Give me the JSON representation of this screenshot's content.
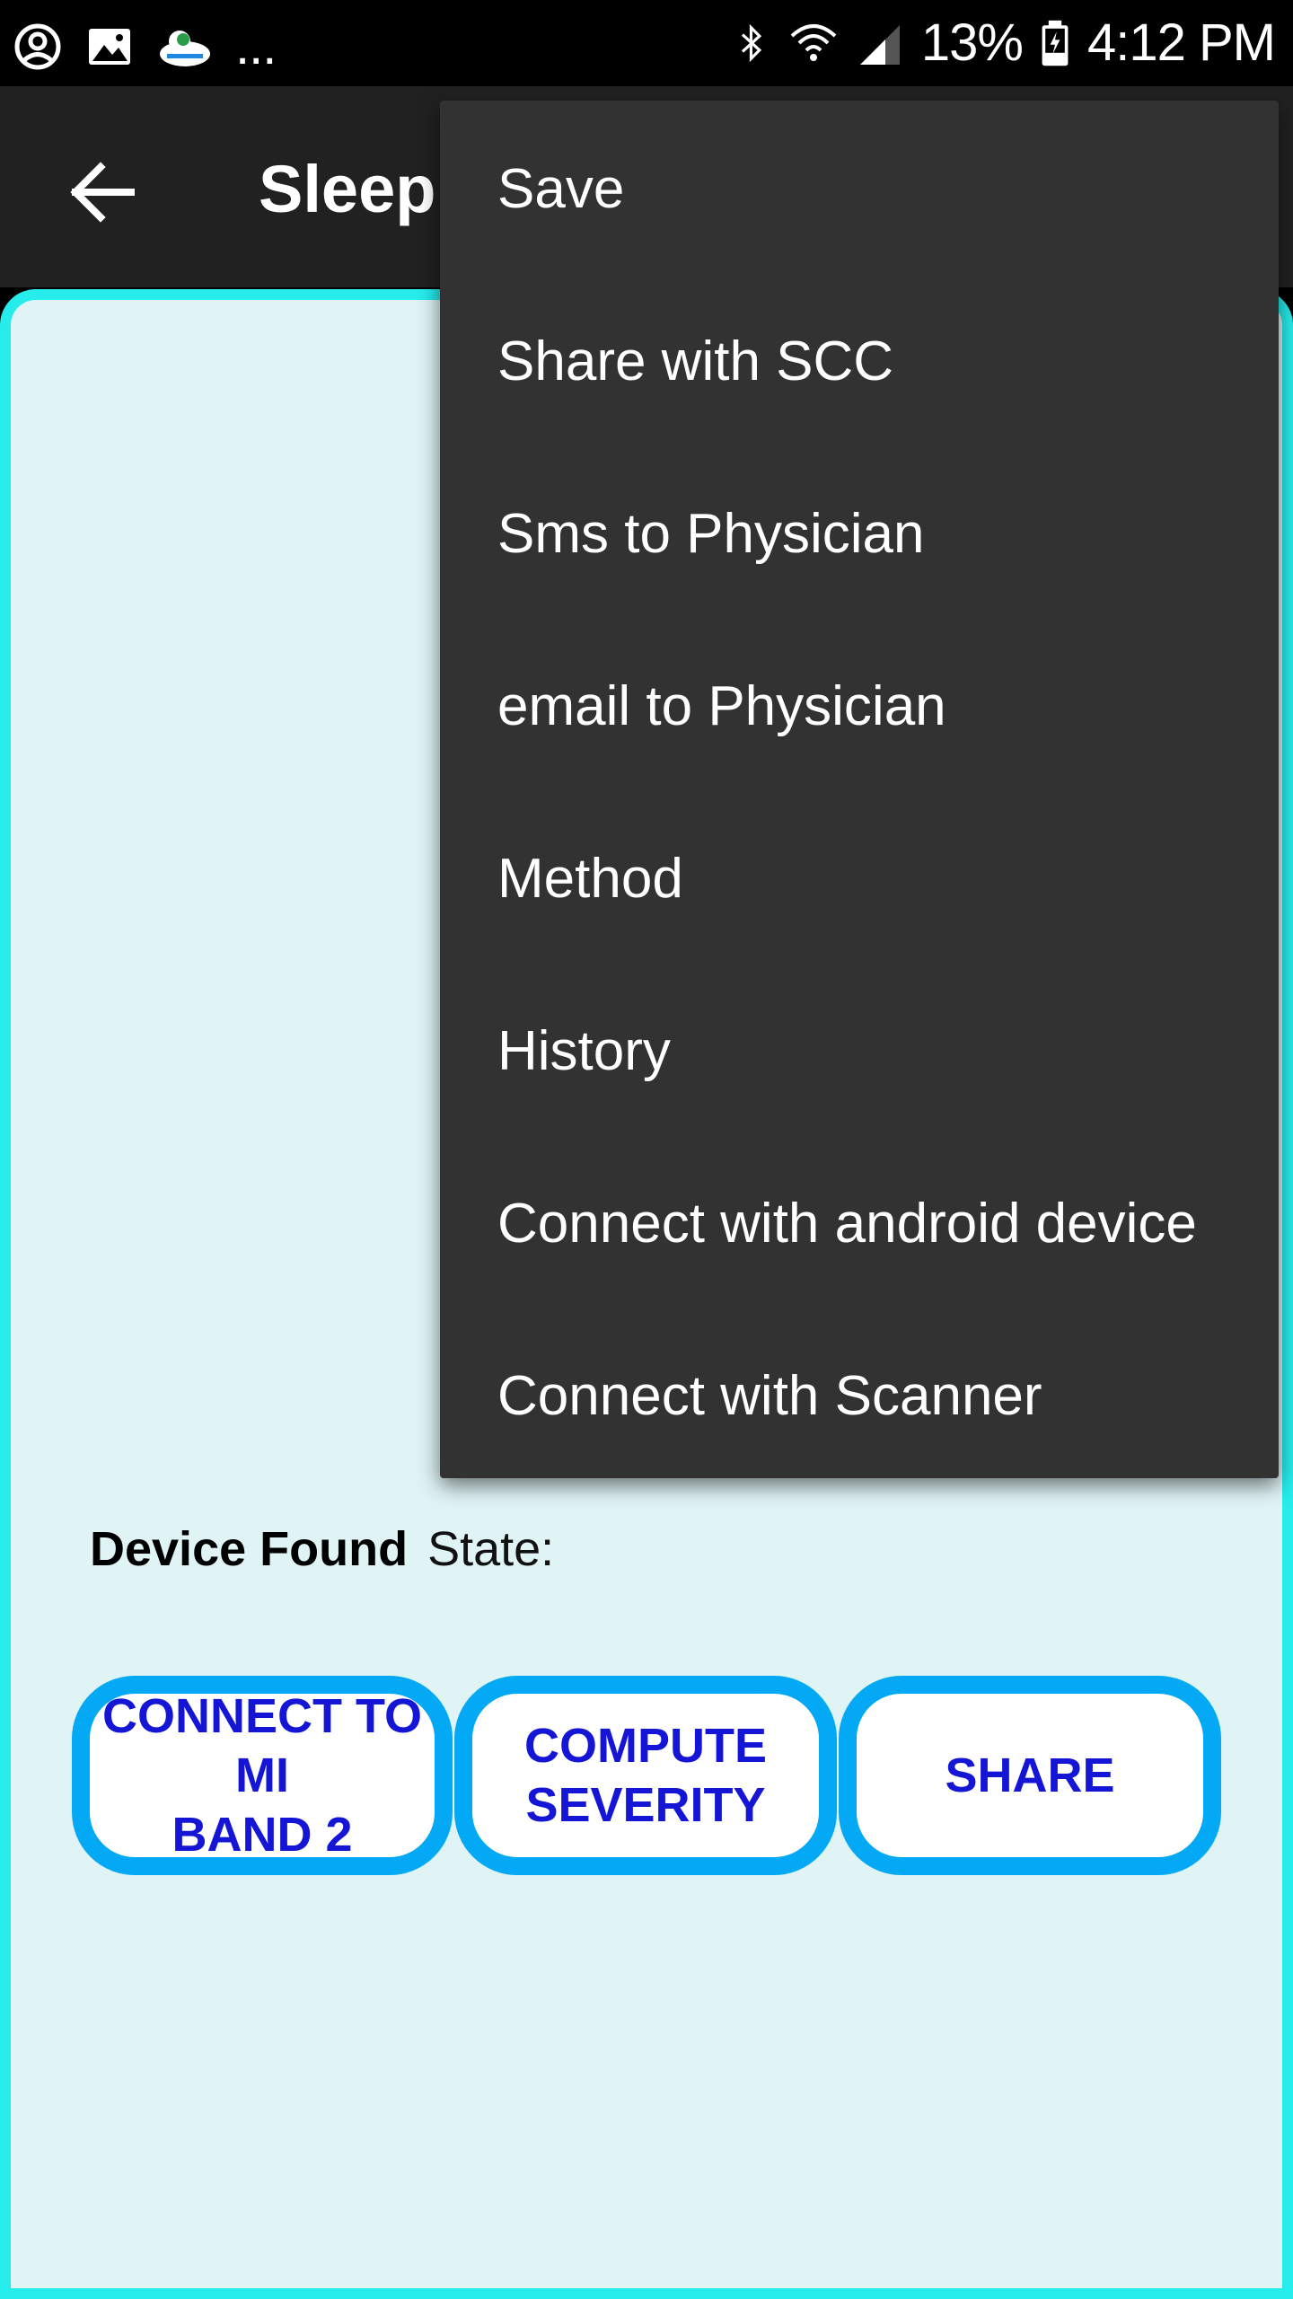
{
  "status_bar": {
    "icons_left": [
      "account-circle-icon",
      "image-icon",
      "app-cloud-icon"
    ],
    "overflow_dots": "...",
    "icons_right": [
      "bluetooth-icon",
      "wifi-icon",
      "signal-icon",
      "battery-icon"
    ],
    "battery_percent": "13%",
    "time": "4:12 PM"
  },
  "app_bar": {
    "title": "Sleep",
    "back_icon": "arrow-back-icon"
  },
  "main": {
    "device_found_label": "Device Found",
    "state_label": "State:",
    "buttons": {
      "connect": "CONNECT TO MI\nBAND 2",
      "compute": "COMPUTE\nSEVERITY",
      "share": "SHARE"
    }
  },
  "menu": {
    "items": [
      "Save",
      "Share with SCC",
      "Sms to Physician",
      "email to Physician",
      "Method",
      "History",
      "Connect with android device",
      "Connect with Scanner"
    ]
  },
  "colors": {
    "status_bar": "#000000",
    "app_bar": "#212121",
    "content_bg": "#e0f4f6",
    "content_border": "#26ecec",
    "button_border": "#03a9f4",
    "button_text": "#1515d6",
    "menu_bg": "#323232"
  }
}
